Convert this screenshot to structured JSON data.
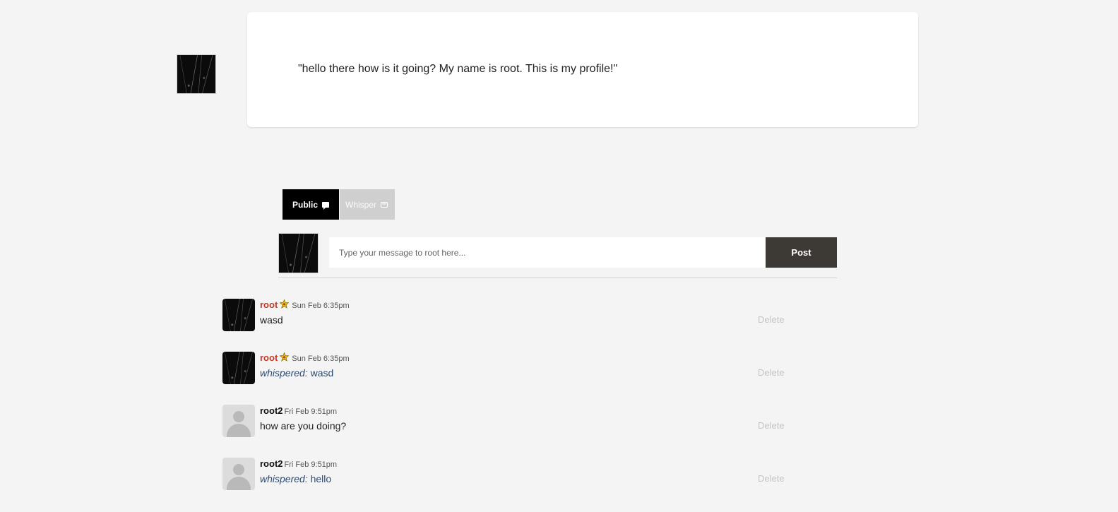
{
  "profile": {
    "quote": "\"hello there how is it going? My name is root. This is my profile!\""
  },
  "tabs": {
    "public_label": "Public",
    "whisper_label": "Whisper"
  },
  "composer": {
    "placeholder": "Type your message to root here...",
    "post_label": "Post"
  },
  "colors": {
    "admin_name": "#c0392b",
    "post_button": "#3d3a36",
    "whisper_text": "#2c4a6e"
  },
  "messages": [
    {
      "user": "root",
      "role": "admin",
      "badge_icon": "admin-badge-icon",
      "time": "Sun Feb 6:35pm",
      "whisper_label": "",
      "text": "wasd",
      "delete_label": "Delete"
    },
    {
      "user": "root",
      "role": "admin",
      "badge_icon": "admin-badge-icon",
      "time": "Sun Feb 6:35pm",
      "whisper_label": "whispered:",
      "text": "wasd",
      "delete_label": "Delete"
    },
    {
      "user": "root2",
      "role": "user",
      "badge_icon": "",
      "time": "Fri Feb 9:51pm",
      "whisper_label": "",
      "text": "how are you doing?",
      "delete_label": "Delete"
    },
    {
      "user": "root2",
      "role": "user",
      "badge_icon": "",
      "time": "Fri Feb 9:51pm",
      "whisper_label": "whispered:",
      "text": "hello",
      "delete_label": "Delete"
    }
  ]
}
